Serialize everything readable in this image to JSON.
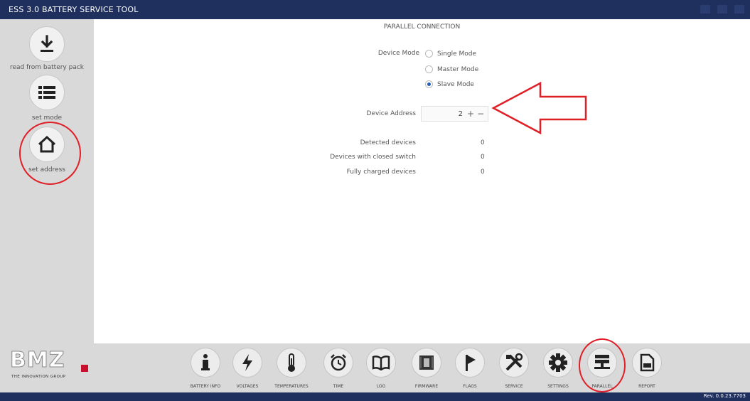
{
  "window": {
    "title": "ESS 3.0 BATTERY SERVICE TOOL"
  },
  "sidebar": {
    "items": [
      {
        "label": "read from battery pack",
        "icon": "download-icon"
      },
      {
        "label": "set mode",
        "icon": "list-icon"
      },
      {
        "label": "set address",
        "icon": "home-icon"
      }
    ]
  },
  "main": {
    "heading": "PARALLEL CONNECTION",
    "device_mode": {
      "label": "Device Mode",
      "options": [
        "Single Mode",
        "Master Mode",
        "Slave Mode"
      ],
      "selected": "Slave Mode"
    },
    "device_address": {
      "label": "Device Address",
      "value": "2",
      "plus": "+",
      "minus": "−"
    },
    "stats": [
      {
        "label": "Detected devices",
        "value": "0"
      },
      {
        "label": "Devices with closed switch",
        "value": "0"
      },
      {
        "label": "Fully charged devices",
        "value": "0"
      }
    ]
  },
  "logo": {
    "text": "BMZ",
    "tagline": "THE INNOVATION GROUP"
  },
  "toolbar": {
    "items": [
      {
        "label": "BATTERY INFO",
        "icon": "info-icon"
      },
      {
        "label": "VOLTAGES",
        "icon": "lightning-icon"
      },
      {
        "label": "TEMPERATURES",
        "icon": "thermometer-icon"
      },
      {
        "label": "TIME",
        "icon": "alarm-clock-icon"
      },
      {
        "label": "LOG",
        "icon": "book-icon"
      },
      {
        "label": "FIRMWARE",
        "icon": "chip-icon"
      },
      {
        "label": "FLAGS",
        "icon": "flag-icon"
      },
      {
        "label": "SERVICE",
        "icon": "tools-icon"
      },
      {
        "label": "SETTINGS",
        "icon": "gear-icon"
      },
      {
        "label": "PARALLEL",
        "icon": "server-icon"
      },
      {
        "label": "REPORT",
        "icon": "pdf-icon"
      }
    ]
  },
  "status": {
    "revision": "Rev. 0.0.23.7703"
  },
  "colors": {
    "titlebar": "#1f2f5e",
    "highlight": "#e01f27",
    "panel": "#d9d9d9"
  }
}
